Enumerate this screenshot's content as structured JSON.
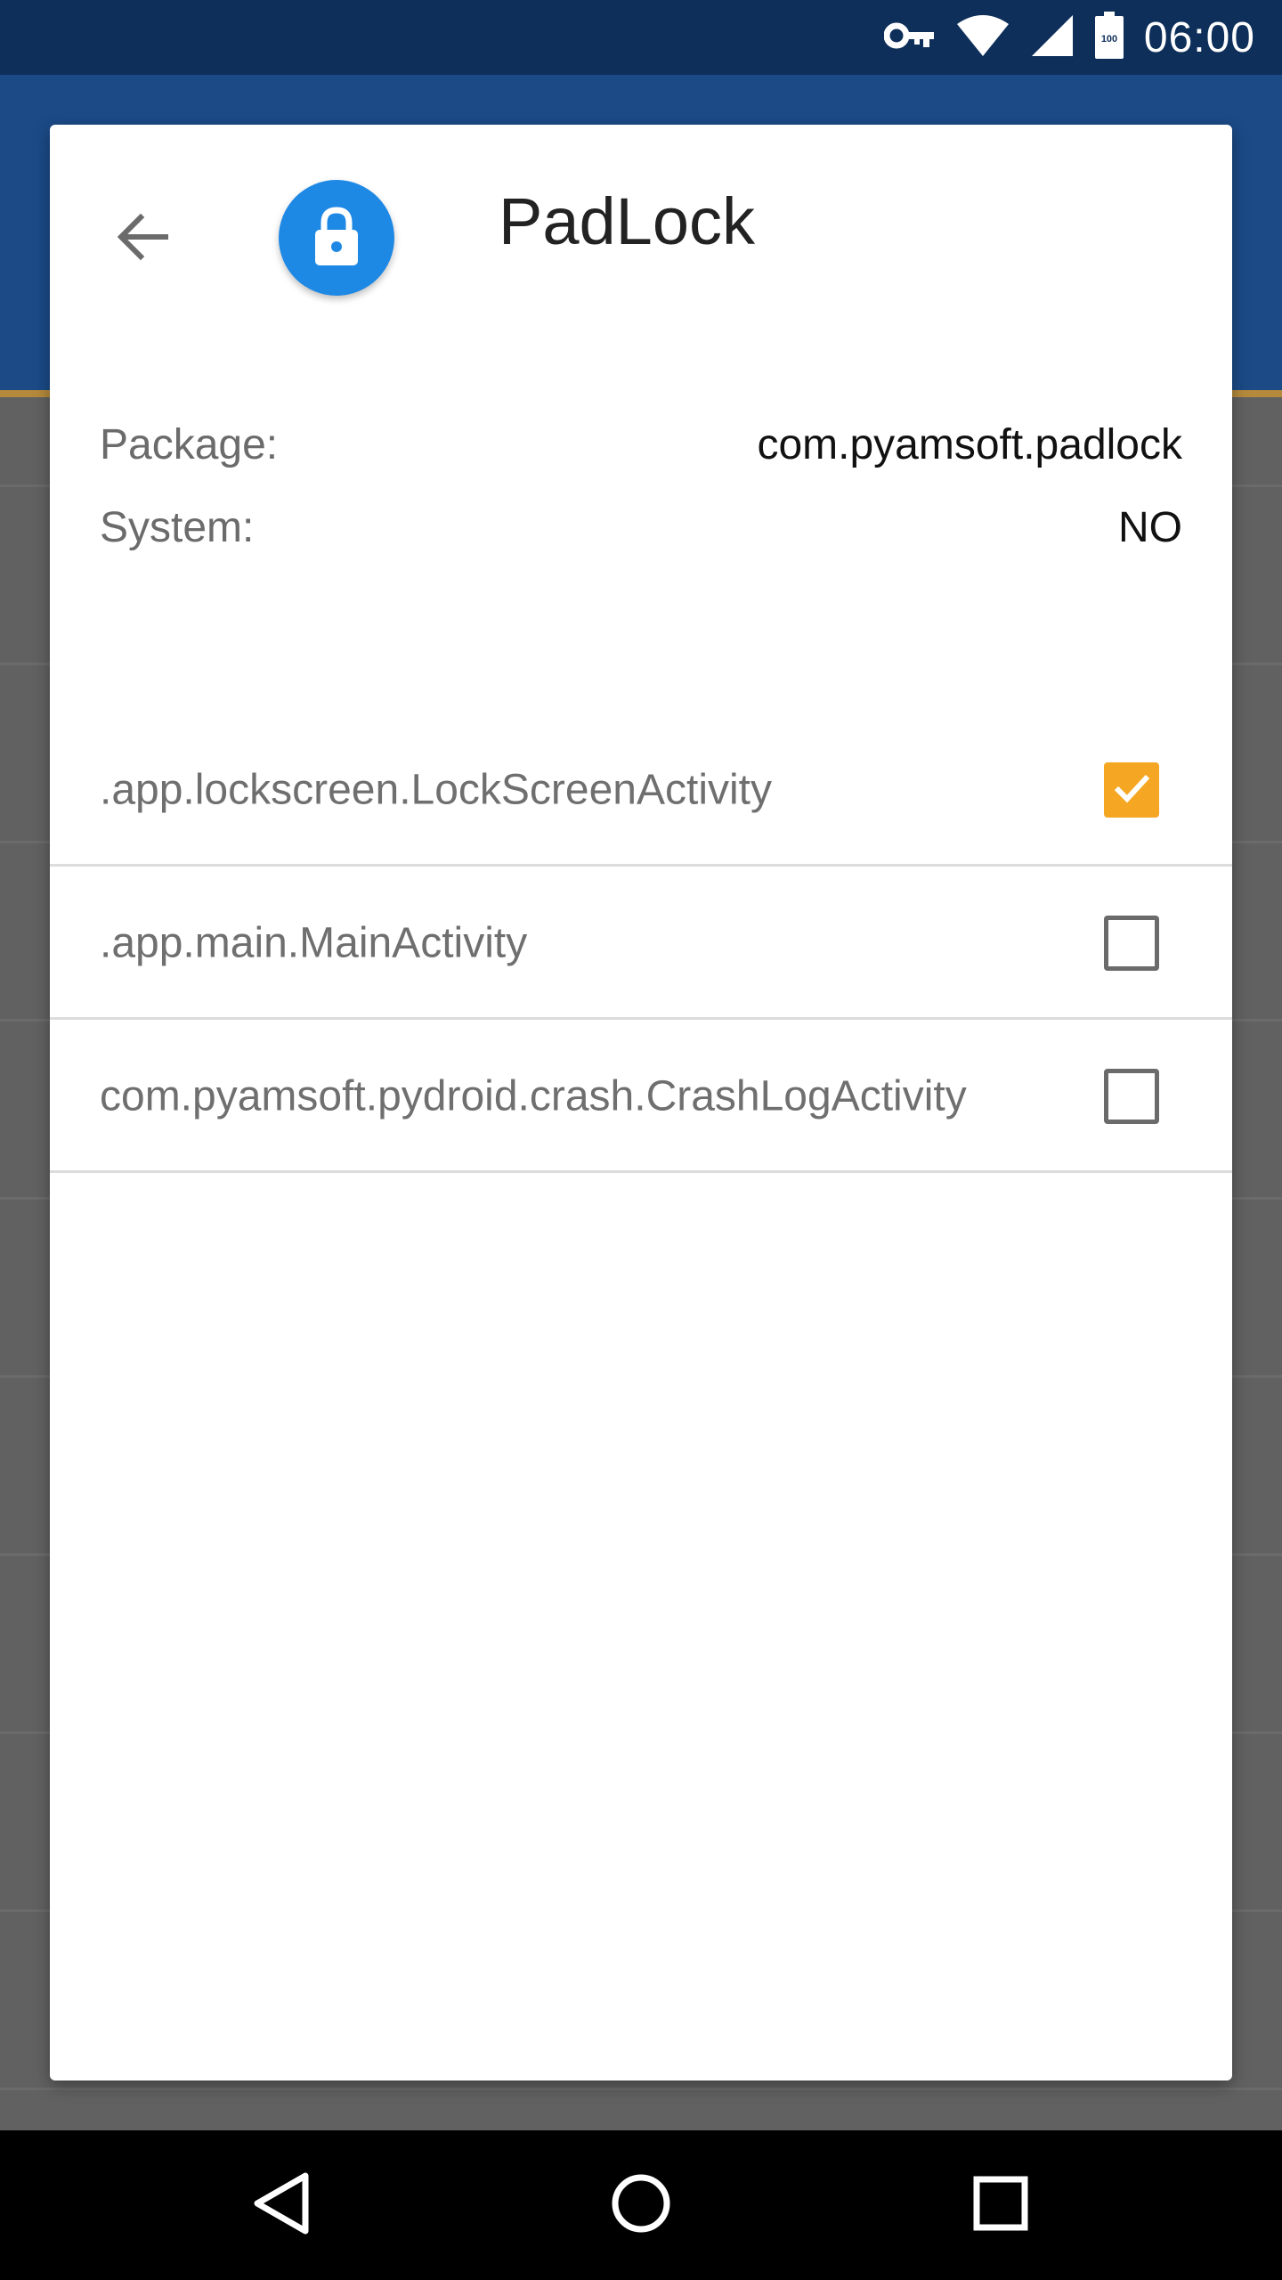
{
  "status_bar": {
    "time": "06:00",
    "battery_level": "100",
    "icons": [
      "vpn-key-icon",
      "wifi-icon",
      "cell-signal-icon",
      "battery-icon"
    ]
  },
  "dialog": {
    "title": "PadLock",
    "app_icon": "lock-icon",
    "back_icon": "arrow-back-icon",
    "info": [
      {
        "label": "Package:",
        "value": "com.pyamsoft.padlock"
      },
      {
        "label": "System:",
        "value": "NO"
      }
    ],
    "activities": [
      {
        "name": ".app.lockscreen.LockScreenActivity",
        "locked": true
      },
      {
        "name": ".app.main.MainActivity",
        "locked": false
      },
      {
        "name": "com.pyamsoft.pydroid.crash.CrashLogActivity",
        "locked": false
      }
    ]
  },
  "nav_bar": {
    "buttons": [
      "back-icon",
      "home-icon",
      "recents-icon"
    ]
  },
  "colors": {
    "status_bar": "#0d2f5a",
    "app_bar": "#1b4a86",
    "app_icon_bg": "#1e88e5",
    "checkbox_checked": "#f5a623"
  }
}
